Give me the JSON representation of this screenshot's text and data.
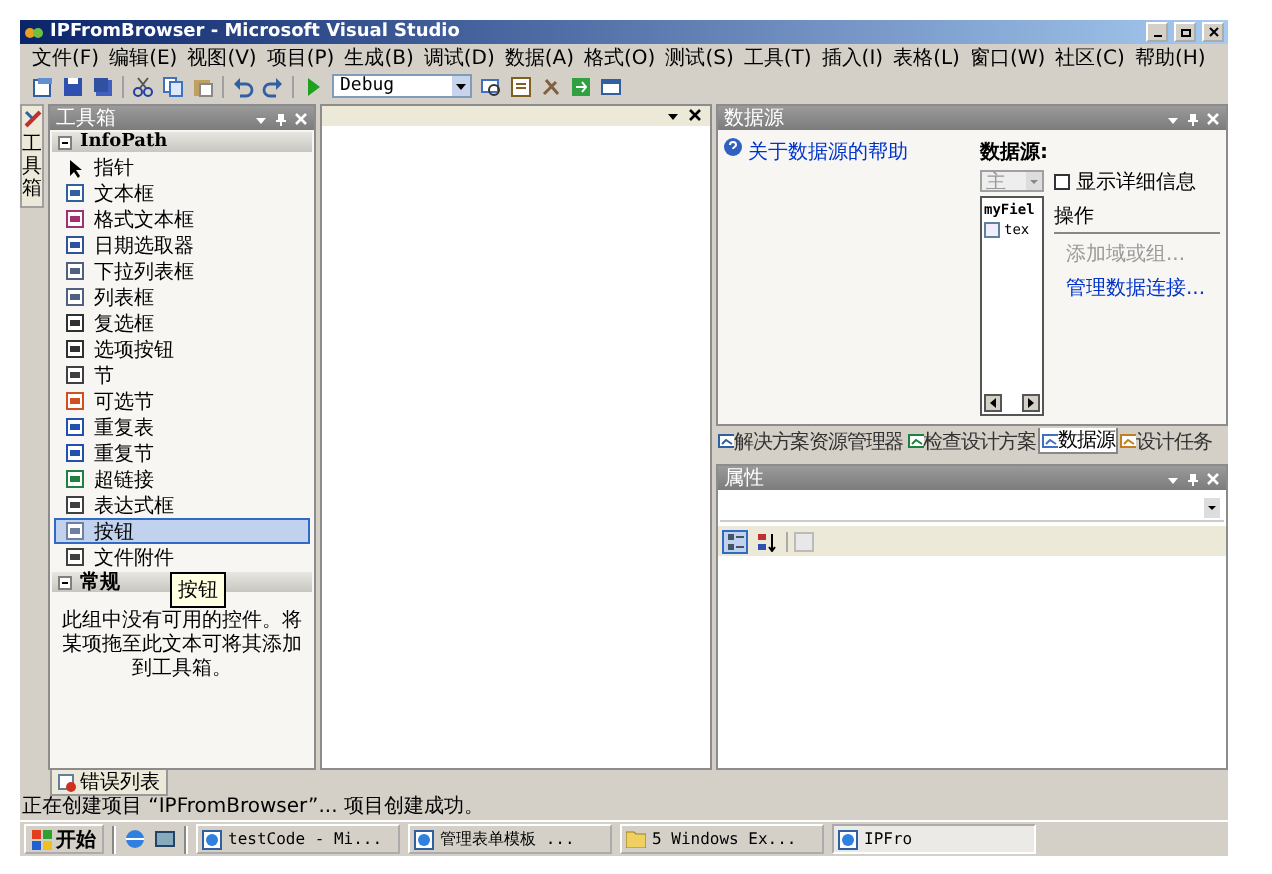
{
  "window": {
    "title": "IPFromBrowser - Microsoft Visual Studio"
  },
  "menu": [
    {
      "label": "文件(F)"
    },
    {
      "label": "编辑(E)"
    },
    {
      "label": "视图(V)"
    },
    {
      "label": "项目(P)"
    },
    {
      "label": "生成(B)"
    },
    {
      "label": "调试(D)"
    },
    {
      "label": "数据(A)"
    },
    {
      "label": "格式(O)"
    },
    {
      "label": "测试(S)"
    },
    {
      "label": "工具(T)"
    },
    {
      "label": "插入(I)"
    },
    {
      "label": "表格(L)"
    },
    {
      "label": "窗口(W)"
    },
    {
      "label": "社区(C)"
    },
    {
      "label": "帮助(H)"
    }
  ],
  "toolbar": {
    "configuration": "Debug"
  },
  "side_strip": {
    "label": "工具箱"
  },
  "toolbox": {
    "title": "工具箱",
    "groups": [
      {
        "name": "InfoPath",
        "expanded": true,
        "items": [
          {
            "label": "指针",
            "selected": false
          },
          {
            "label": "文本框",
            "selected": false
          },
          {
            "label": "格式文本框",
            "selected": false
          },
          {
            "label": "日期选取器",
            "selected": false
          },
          {
            "label": "下拉列表框",
            "selected": false
          },
          {
            "label": "列表框",
            "selected": false
          },
          {
            "label": "复选框",
            "selected": false
          },
          {
            "label": "选项按钮",
            "selected": false
          },
          {
            "label": "节",
            "selected": false
          },
          {
            "label": "可选节",
            "selected": false
          },
          {
            "label": "重复表",
            "selected": false
          },
          {
            "label": "重复节",
            "selected": false
          },
          {
            "label": "超链接",
            "selected": false
          },
          {
            "label": "表达式框",
            "selected": false
          },
          {
            "label": "按钮",
            "selected": true
          },
          {
            "label": "文件附件",
            "selected": false
          }
        ]
      },
      {
        "name": "常规",
        "expanded": true,
        "empty_text": "此组中没有可用的控件。将某项拖至此文本可将其添加到工具箱。"
      }
    ],
    "tooltip": "按钮"
  },
  "data_source": {
    "title": "数据源",
    "help_link": "关于数据源的帮助",
    "source_label": "数据源:",
    "source_select": {
      "value": "主",
      "disabled": true
    },
    "tree": [
      {
        "label": "myFiel"
      },
      {
        "label": "tex"
      }
    ],
    "show_details": {
      "label": "显示详细信息",
      "checked": false
    },
    "actions_title": "操作",
    "actions": [
      {
        "label": "添加域或组...",
        "disabled": true
      },
      {
        "label": "管理数据连接...",
        "disabled": false
      }
    ]
  },
  "panel_tabs": [
    {
      "label": "解决方案资源管理器",
      "selected": false
    },
    {
      "label": "检查设计方案",
      "selected": false
    },
    {
      "label": "数据源",
      "selected": true
    },
    {
      "label": "设计任务",
      "selected": false
    }
  ],
  "properties": {
    "title": "属性",
    "buttons": [
      {
        "kind": "categorized",
        "selected": true
      },
      {
        "kind": "alphabetical",
        "selected": false
      }
    ]
  },
  "bottom_tab": {
    "label": "错误列表"
  },
  "status_bar": "正在创建项目 “IPFromBrowser”... 项目创建成功。",
  "taskbar": {
    "start": "开始",
    "tasks": [
      {
        "label": "testCode - Mi...",
        "selected": false
      },
      {
        "label": "管理表单模板 ...",
        "selected": false
      },
      {
        "label": "5 Windows Ex...",
        "selected": false
      },
      {
        "label": "IPFro",
        "selected": true
      }
    ]
  }
}
